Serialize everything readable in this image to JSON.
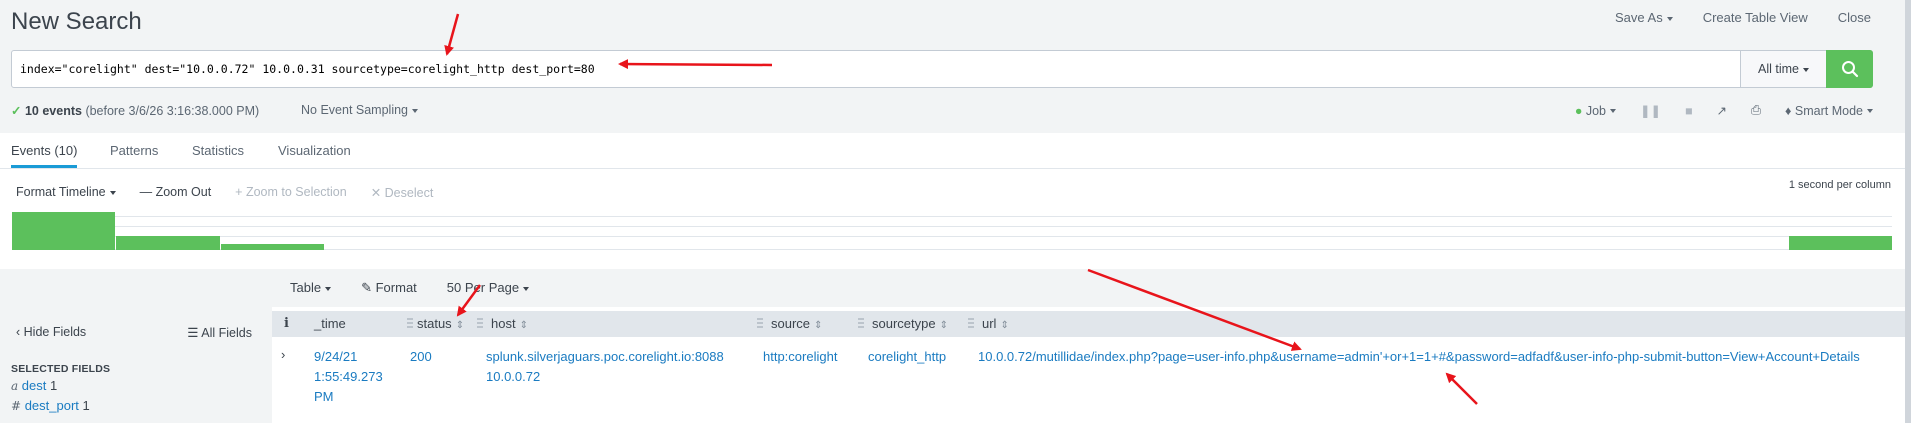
{
  "header": {
    "title": "New Search",
    "save_as": "Save As",
    "create_table_view": "Create Table View",
    "close": "Close"
  },
  "search": {
    "query": "index=\"corelight\" dest=\"10.0.0.72\" 10.0.0.31 sourcetype=corelight_http dest_port=80",
    "time_range": "All time",
    "button_icon": "search-icon"
  },
  "status": {
    "check": "✓",
    "event_count": "10 events",
    "before": "(before 3/6/26 3:16:38.000 PM)",
    "sampling": "No Event Sampling",
    "job": "Job",
    "mode": "Smart Mode"
  },
  "tabs": [
    {
      "label": "Events (10)",
      "active": true
    },
    {
      "label": "Patterns",
      "active": false
    },
    {
      "label": "Statistics",
      "active": false
    },
    {
      "label": "Visualization",
      "active": false
    }
  ],
  "timeline": {
    "format": "Format Timeline",
    "zoom_out": "Zoom Out",
    "zoom_selection": "Zoom to Selection",
    "deselect": "Deselect",
    "scale": "1 second per column",
    "bar_color": "#5cc05c"
  },
  "results_toolbar": {
    "table": "Table",
    "format": "Format",
    "per_page": "50 Per Page"
  },
  "fields_panel": {
    "hide_fields": "Hide Fields",
    "all_fields": "All Fields",
    "selected_heading": "SELECTED FIELDS",
    "fields": [
      {
        "type": "a",
        "name": "dest",
        "count": "1"
      },
      {
        "type": "#",
        "name": "dest_port",
        "count": "1"
      }
    ]
  },
  "table": {
    "info_icon": "i",
    "columns": [
      "_time",
      "status",
      "host",
      "source",
      "sourcetype",
      "url"
    ],
    "rows": [
      {
        "time_line1": "9/24/21",
        "time_line2": "1:55:49.273",
        "time_line3": "PM",
        "status": "200",
        "host_line1": "splunk.silverjaguars.poc.corelight.io:8088",
        "host_line2": "10.0.0.72",
        "source": "http:corelight",
        "sourcetype": "corelight_http",
        "url": "10.0.0.72/mutillidae/index.php?page=user-info.php&username=admin'+or+1=1+#&password=adfadf&user-info-php-submit-button=View+Account+Details"
      }
    ]
  },
  "colors": {
    "accent": "#1a9bd6",
    "link": "#1a7bc1",
    "search_button": "#5cc05c",
    "annotation_arrow": "#e8141b"
  }
}
